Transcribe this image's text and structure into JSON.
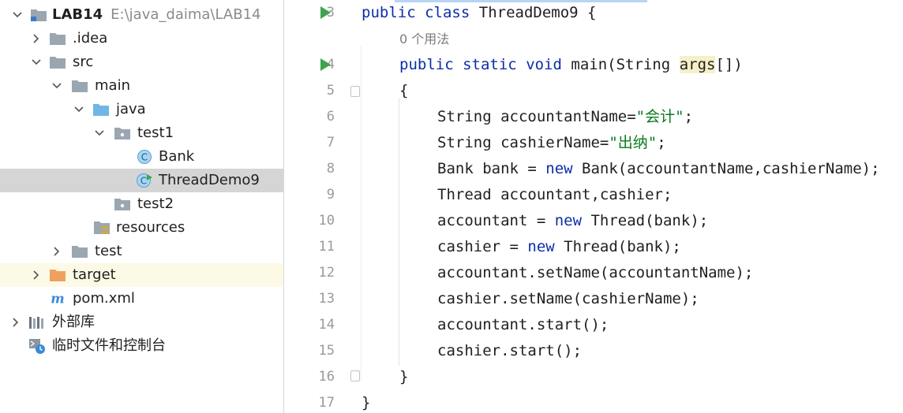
{
  "project_tree": {
    "root": {
      "name": "LAB14",
      "path": "E:\\java_daima\\LAB14"
    },
    "items": [
      {
        "label": ".idea"
      },
      {
        "label": "src"
      },
      {
        "label": "main"
      },
      {
        "label": "java"
      },
      {
        "label": "test1"
      },
      {
        "label": "Bank"
      },
      {
        "label": "ThreadDemo9"
      },
      {
        "label": "test2"
      },
      {
        "label": "resources"
      },
      {
        "label": "test"
      },
      {
        "label": "target"
      },
      {
        "label": "pom.xml"
      },
      {
        "label": "外部库"
      },
      {
        "label": "临时文件和控制台"
      }
    ]
  },
  "editor": {
    "usage_hint": "0 个用法",
    "line_numbers": [
      "3",
      "4",
      "5",
      "6",
      "7",
      "8",
      "9",
      "10",
      "11",
      "12",
      "13",
      "14",
      "15",
      "16",
      "17"
    ],
    "code": {
      "l3": {
        "kw1": "public",
        "kw2": "class",
        "rest": "ThreadDemo9 {"
      },
      "l4": {
        "kw1": "public",
        "kw2": "static",
        "kw3": "void",
        "name": "main(String ",
        "param": "args",
        "rest": "[])"
      },
      "l5": "{",
      "l6": {
        "pre": "String accountantName=",
        "str": "\"会计\"",
        "post": ";"
      },
      "l7": {
        "pre": "String cashierName=",
        "str": "\"出纳\"",
        "post": ";"
      },
      "l8": {
        "pre": "Bank bank = ",
        "kw": "new",
        "post": " Bank(accountantName,cashierName);"
      },
      "l9": "Thread accountant,cashier;",
      "l10": {
        "pre": "accountant = ",
        "kw": "new",
        "post": " Thread(bank);"
      },
      "l11": {
        "pre": "cashier = ",
        "kw": "new",
        "post": " Thread(bank);"
      },
      "l12": "accountant.setName(accountantName);",
      "l13": "cashier.setName(cashierName);",
      "l14": "accountant.start();",
      "l15": "cashier.start();",
      "l16": "}",
      "l17": "}"
    }
  }
}
